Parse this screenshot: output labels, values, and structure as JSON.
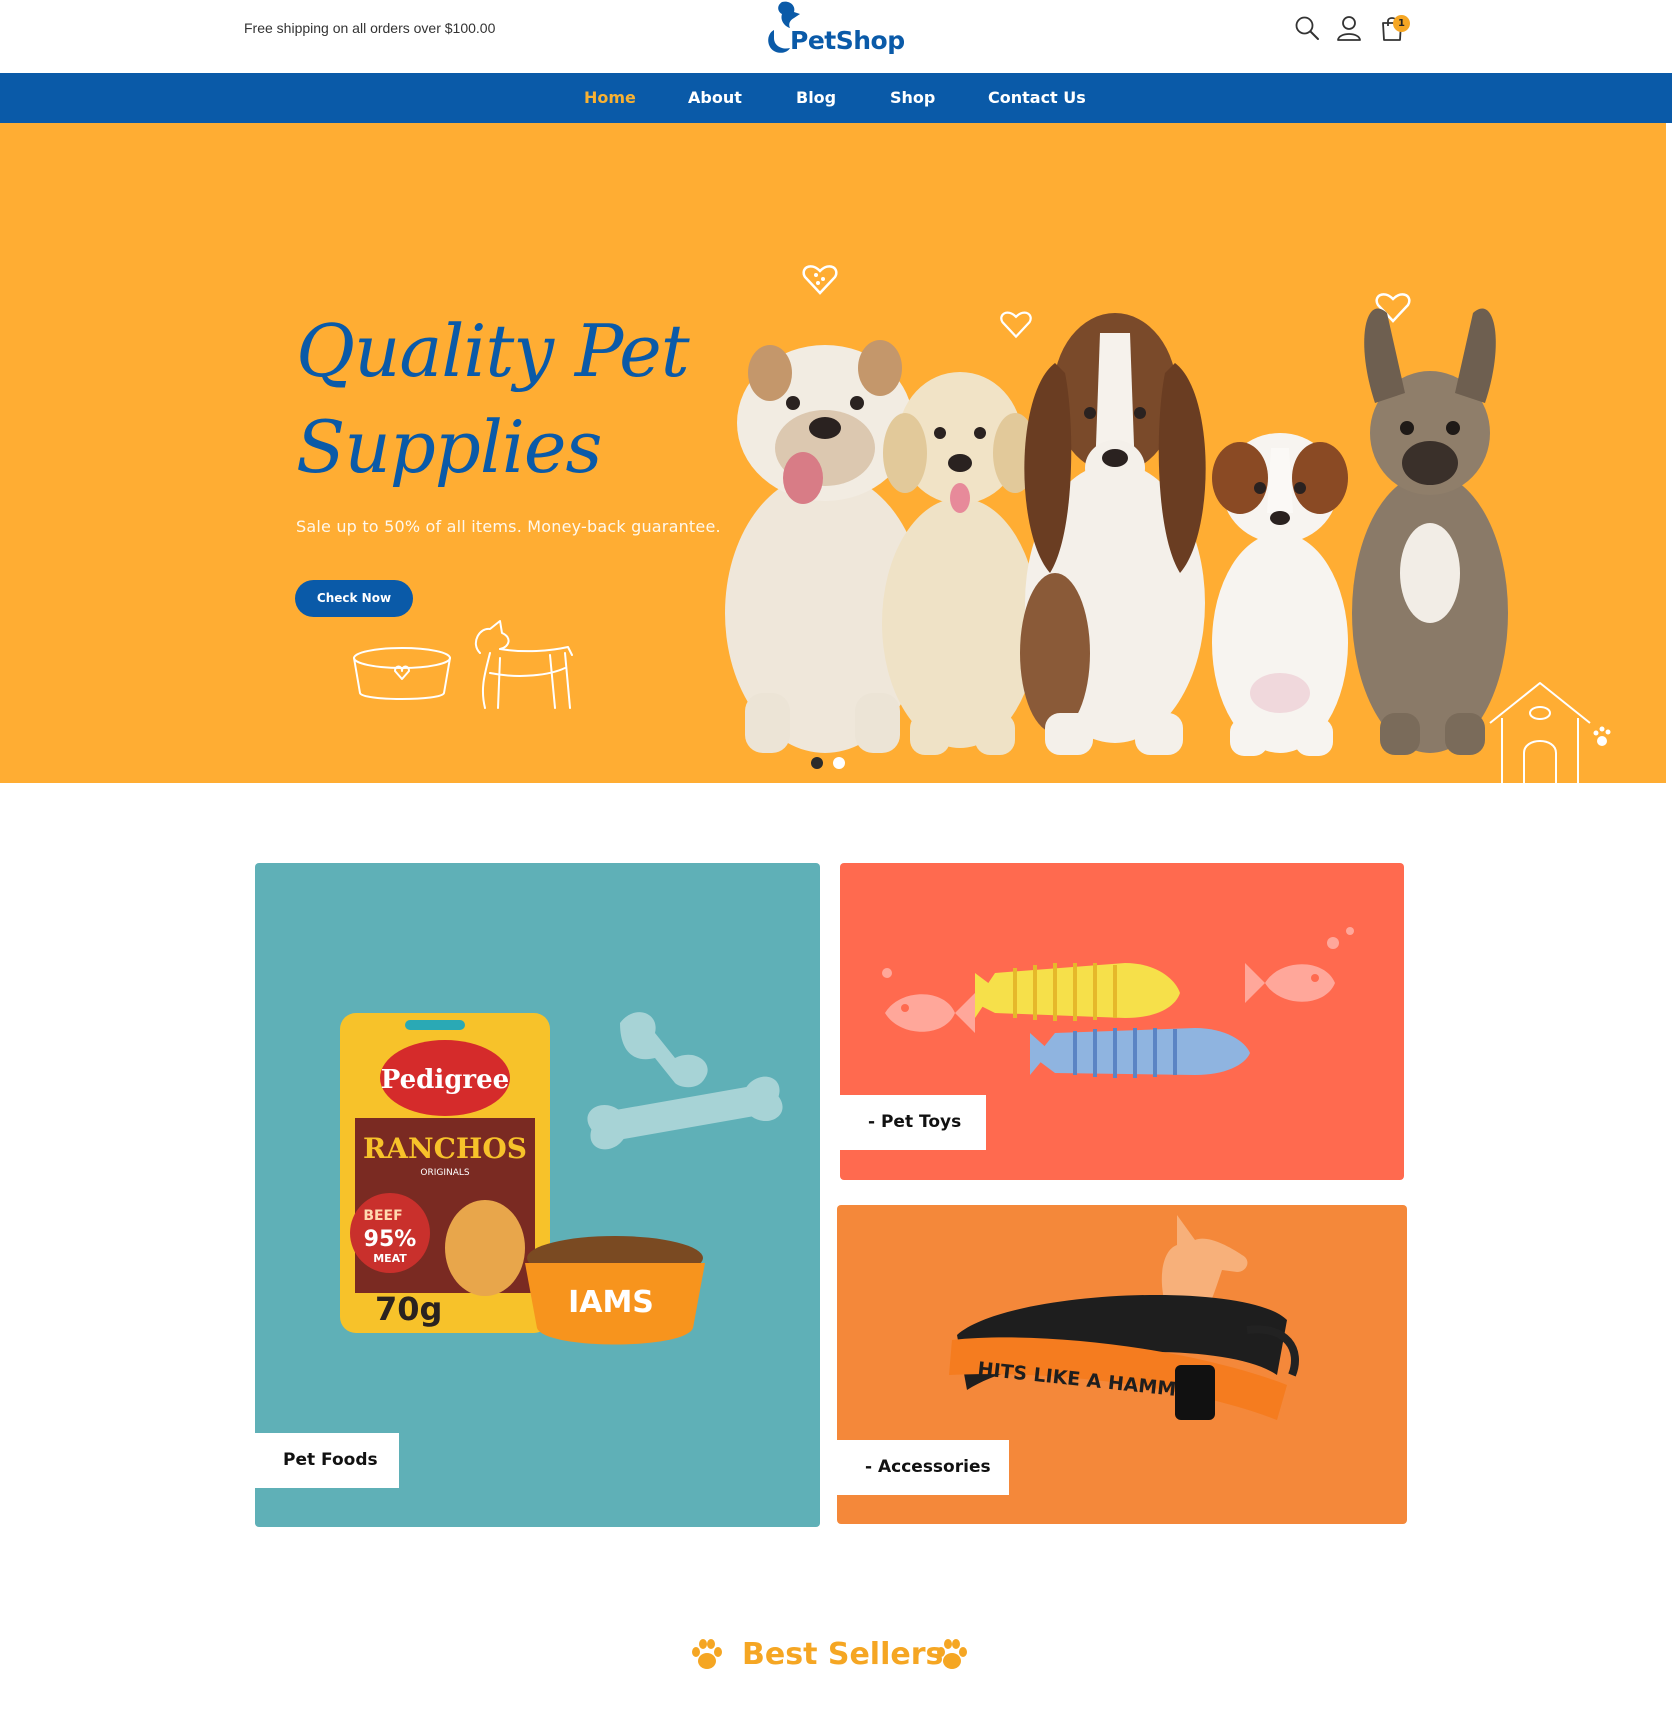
{
  "topbar": {
    "shipping_text": "Free shipping on all orders over $100.00",
    "logo_text": "PetShop",
    "icons": [
      "search-icon",
      "user-icon",
      "cart-icon"
    ],
    "cart_count": "1"
  },
  "nav": {
    "items": [
      {
        "label": "Home",
        "active": true
      },
      {
        "label": "About",
        "active": false
      },
      {
        "label": "Blog",
        "active": false
      },
      {
        "label": "Shop",
        "active": false
      },
      {
        "label": "Contact Us",
        "active": false
      }
    ]
  },
  "hero": {
    "title_line1": "Quality Pet",
    "title_line2": "Supplies",
    "subtitle": "Sale up to 50% of all items. Money-back guarantee.",
    "button_label": "Check Now",
    "slides_total": 2,
    "active_slide": 1
  },
  "product_text": {
    "pedigree_brand": "Pedigree",
    "pedigree_product": "RANCHOS",
    "pedigree_sub": "ORIGINALS",
    "pedigree_flavor": "BEEF",
    "pedigree_percent": "95%",
    "pedigree_meat": "MEAT",
    "pedigree_weight": "70g",
    "bowl_brand": "IAMS",
    "collar_text": "HITS LIKE A HAMMER"
  },
  "categories": [
    {
      "label": "Pet Foods",
      "bg": "#5fb0b7"
    },
    {
      "label": "- Pet Toys",
      "bg": "#ff6a4f"
    },
    {
      "label": "- Accessories",
      "bg": "#f4883a"
    }
  ],
  "best_sellers": {
    "title": "Best Sellers",
    "icon": "paw-icon"
  },
  "colors": {
    "brand_blue": "#0a5aa8",
    "accent_orange": "#ffad33",
    "nav_active": "#f8b133"
  }
}
